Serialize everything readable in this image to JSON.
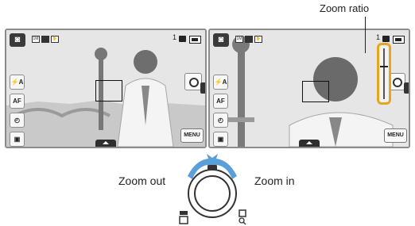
{
  "callout": {
    "zoom_ratio_label": "Zoom ratio"
  },
  "zoom_out_label": "Zoom out",
  "zoom_in_label": "Zoom in",
  "left_screen": {
    "shots_remaining": "1",
    "menu_label": "MENU",
    "buttons": {
      "flash": "⚡A",
      "af": "AF",
      "timer": "◴",
      "display": "▣"
    }
  },
  "right_screen": {
    "shots_remaining": "1",
    "menu_label": "MENU",
    "buttons": {
      "flash": "⚡A",
      "af": "AF",
      "timer": "◴",
      "display": "▣"
    },
    "zoom_level": 0.35
  },
  "icons": {
    "mode": "camera-mode-icon",
    "zoom_wide": "wide-grid-icon",
    "zoom_tele": "tele-search-icon"
  },
  "colors": {
    "zoom_highlight": "#e5a520",
    "arrow": "#5b9fd8"
  }
}
